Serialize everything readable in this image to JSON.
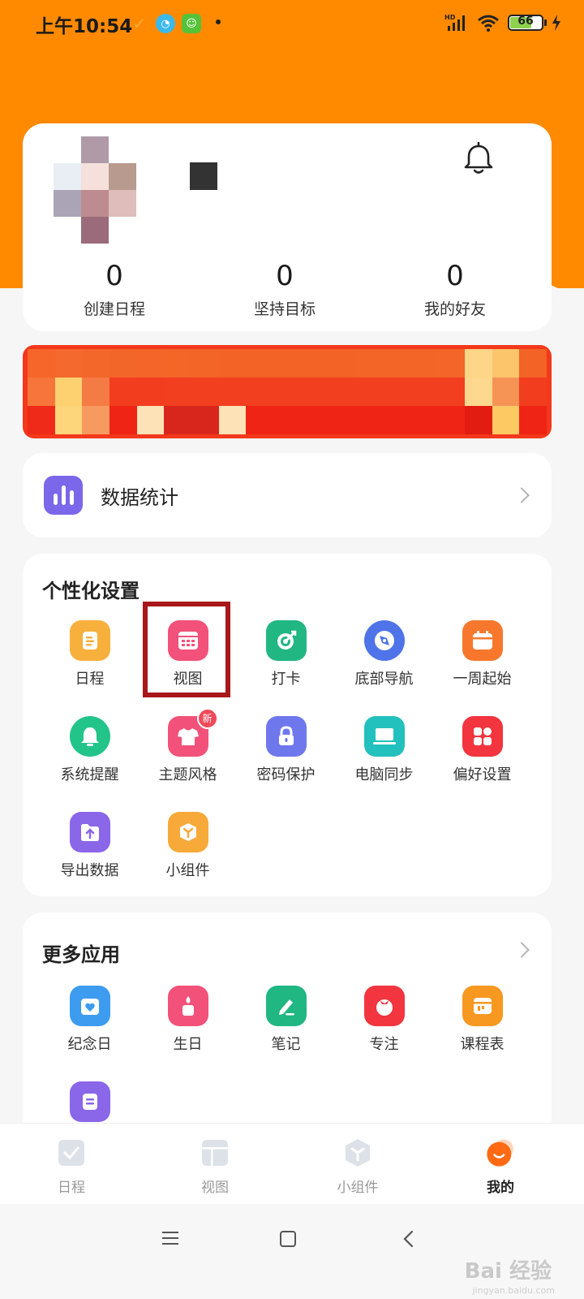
{
  "status_bar": {
    "time": "上午10:54",
    "battery": "66",
    "network": "HD"
  },
  "profile": {
    "stats": [
      {
        "value": "0",
        "label": "创建日程"
      },
      {
        "value": "0",
        "label": "坚持目标"
      },
      {
        "value": "0",
        "label": "我的好友"
      }
    ]
  },
  "data_stats": {
    "label": "数据统计"
  },
  "personalization": {
    "title": "个性化设置",
    "items": [
      {
        "label": "日程",
        "icon": "schedule-icon",
        "color": "#f7b03c"
      },
      {
        "label": "视图",
        "icon": "view-grid-icon",
        "color": "#f2517a"
      },
      {
        "label": "打卡",
        "icon": "checkin-target-icon",
        "color": "#20b782"
      },
      {
        "label": "底部导航",
        "icon": "compass-icon",
        "color": "#4f73e8"
      },
      {
        "label": "一周起始",
        "icon": "calendar-icon",
        "color": "#f7782d"
      },
      {
        "label": "系统提醒",
        "icon": "bell-icon",
        "color": "#23c48a"
      },
      {
        "label": "主题风格",
        "icon": "tshirt-icon",
        "color": "#f2517a",
        "badge": "新"
      },
      {
        "label": "密码保护",
        "icon": "lock-icon",
        "color": "#6e78ec"
      },
      {
        "label": "电脑同步",
        "icon": "laptop-icon",
        "color": "#22c1bd"
      },
      {
        "label": "偏好设置",
        "icon": "apps-icon",
        "color": "#f2353f"
      },
      {
        "label": "导出数据",
        "icon": "export-folder-icon",
        "color": "#8a66e8"
      },
      {
        "label": "小组件",
        "icon": "widget-cube-icon",
        "color": "#f7a93a"
      }
    ]
  },
  "more_apps": {
    "title": "更多应用",
    "items": [
      {
        "label": "纪念日",
        "icon": "anniversary-icon",
        "color": "#3e9cf0"
      },
      {
        "label": "生日",
        "icon": "birthday-candle-icon",
        "color": "#f2517a"
      },
      {
        "label": "笔记",
        "icon": "note-pen-icon",
        "color": "#20b782"
      },
      {
        "label": "专注",
        "icon": "tomato-icon",
        "color": "#f2353f"
      },
      {
        "label": "课程表",
        "icon": "timetable-icon",
        "color": "#f79820"
      },
      {
        "label": "",
        "icon": "document-icon",
        "color": "#8a66e8"
      }
    ]
  },
  "tabbar": {
    "tabs": [
      {
        "label": "日程",
        "icon": "checkbox-icon",
        "active": false
      },
      {
        "label": "视图",
        "icon": "layout-icon",
        "active": false
      },
      {
        "label": "小组件",
        "icon": "cube-icon",
        "active": false
      },
      {
        "label": "我的",
        "icon": "smile-avatar-icon",
        "active": true
      }
    ]
  },
  "watermark": {
    "brand": "Bai 经验",
    "url": "jingyan.baidu.com"
  }
}
